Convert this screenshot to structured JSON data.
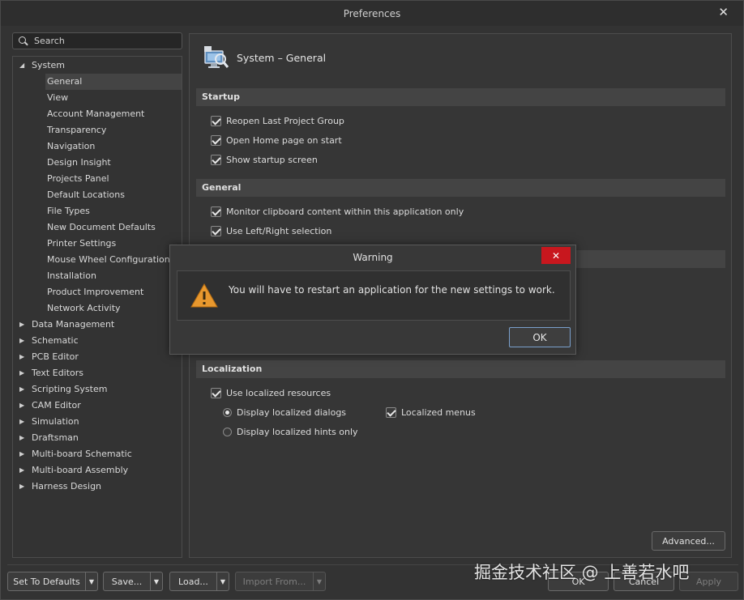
{
  "window": {
    "title": "Preferences",
    "close_glyph": "✕"
  },
  "search": {
    "placeholder": "Search"
  },
  "tree": [
    {
      "label": "System",
      "level": 0,
      "expanded": true
    },
    {
      "label": "General",
      "level": 1,
      "selected": true
    },
    {
      "label": "View",
      "level": 1
    },
    {
      "label": "Account Management",
      "level": 1
    },
    {
      "label": "Transparency",
      "level": 1
    },
    {
      "label": "Navigation",
      "level": 1
    },
    {
      "label": "Design Insight",
      "level": 1
    },
    {
      "label": "Projects Panel",
      "level": 1
    },
    {
      "label": "Default Locations",
      "level": 1
    },
    {
      "label": "File Types",
      "level": 1
    },
    {
      "label": "New Document Defaults",
      "level": 1
    },
    {
      "label": "Printer Settings",
      "level": 1
    },
    {
      "label": "Mouse Wheel Configuration",
      "level": 1
    },
    {
      "label": "Installation",
      "level": 1
    },
    {
      "label": "Product Improvement",
      "level": 1
    },
    {
      "label": "Network Activity",
      "level": 1
    },
    {
      "label": "Data Management",
      "level": 0
    },
    {
      "label": "Schematic",
      "level": 0
    },
    {
      "label": "PCB Editor",
      "level": 0
    },
    {
      "label": "Text Editors",
      "level": 0
    },
    {
      "label": "Scripting System",
      "level": 0
    },
    {
      "label": "CAM Editor",
      "level": 0
    },
    {
      "label": "Simulation",
      "level": 0
    },
    {
      "label": "Draftsman",
      "level": 0
    },
    {
      "label": "Multi-board Schematic",
      "level": 0
    },
    {
      "label": "Multi-board Assembly",
      "level": 0
    },
    {
      "label": "Harness Design",
      "level": 0
    }
  ],
  "page": {
    "title": "System – General",
    "icon": "system-general-icon"
  },
  "sections": {
    "startup": {
      "title": "Startup",
      "options": [
        {
          "label": "Reopen Last Project Group",
          "checked": true
        },
        {
          "label": "Open Home page on start",
          "checked": true
        },
        {
          "label": "Show startup screen",
          "checked": true
        }
      ]
    },
    "general": {
      "title": "General",
      "options": [
        {
          "label": "Monitor clipboard content within this application only",
          "checked": true
        },
        {
          "label": "Use Left/Right selection",
          "checked": true
        }
      ]
    },
    "localization": {
      "title": "Localization",
      "use_resources": {
        "label": "Use localized resources",
        "checked": true
      },
      "radio_dialogs": {
        "label": "Display localized dialogs",
        "selected": true
      },
      "radio_hints": {
        "label": "Display localized hints only",
        "selected": false
      },
      "localized_menus": {
        "label": "Localized menus",
        "checked": true
      }
    }
  },
  "buttons": {
    "advanced": "Advanced...",
    "set_defaults": "Set To Defaults",
    "save": "Save...",
    "load": "Load...",
    "import_from": "Import From...",
    "ok": "OK",
    "cancel": "Cancel",
    "apply": "Apply",
    "dropdown_glyph": "▼"
  },
  "warning_dialog": {
    "title": "Warning",
    "message": "You will have to restart an application for the new settings to work.",
    "ok": "OK",
    "close_glyph": "✕",
    "icon": "warning-triangle-icon",
    "accent": "#c8171e"
  },
  "watermark": "掘金技术社区 @ 上善若水吧"
}
